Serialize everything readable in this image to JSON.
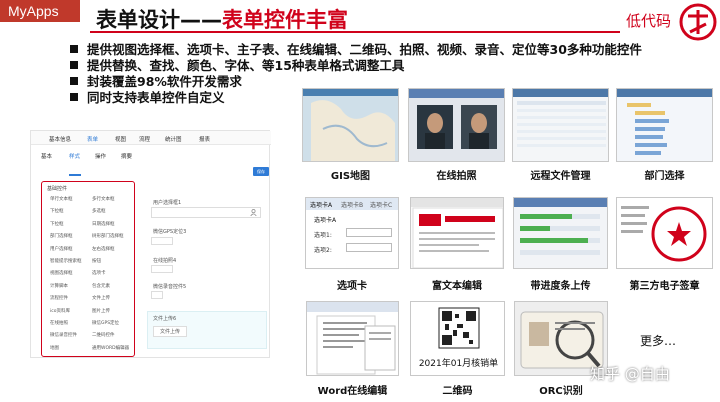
{
  "brand": "MyApps",
  "title_prefix": "表单设计——",
  "title_highlight": "表单控件丰富",
  "tag": "低代码",
  "bullets": [
    "提供视图选择框、选项卡、主子表、在线编辑、二维码、拍照、视频、录音、定位等30多种功能控件",
    "提供替换、查找、颜色、字体、等15种表单格式调整工具",
    "封装覆盖98%软件开发需求",
    "同时支持表单控件自定义"
  ],
  "form": {
    "top_tabs": [
      "基本信息",
      "表单",
      "视图",
      "流程",
      "统计图",
      "报表"
    ],
    "sub_tabs": [
      "基本",
      "样式",
      "操作",
      "摘要"
    ],
    "button": "保存",
    "palette_title": "基础控件",
    "palette_items": [
      [
        "单行文本框",
        "多行文本框"
      ],
      [
        "下拉框",
        "多选框"
      ],
      [
        "下拉框",
        "日期选择框"
      ],
      [
        "部门选择框",
        "树形部门选择框"
      ],
      [
        "用户选择框",
        "左右选择框"
      ],
      [
        "智能提示搜索框",
        "按钮"
      ],
      [
        "视图选择框",
        "选项卡"
      ],
      [
        "计算脚本",
        "包含元素"
      ],
      [
        "流程控件",
        "文件上传"
      ],
      [
        "ico资料库",
        "图片上传"
      ],
      [
        "在线拍照",
        "微信GPS定位"
      ],
      [
        "微信录音控件",
        "二维码控件"
      ],
      [
        "地图",
        "通用WORD编辑器"
      ]
    ],
    "fields": [
      "用户选择框1",
      "微信GPS定位3",
      "在线拍照4",
      "微信录音控件5",
      "文件上传6"
    ],
    "upload_button": "文件上传"
  },
  "gallery": [
    {
      "caption": "GIS地图"
    },
    {
      "caption": "在线拍照"
    },
    {
      "caption": "远程文件管理"
    },
    {
      "caption": "部门选择"
    },
    {
      "caption": "选项卡",
      "tab_labels": [
        "选项卡A",
        "选项卡B",
        "选项卡C"
      ],
      "inner_title": "选项卡A",
      "inner_fields": [
        "选项1:",
        "选项2:"
      ]
    },
    {
      "caption": "富文本编辑"
    },
    {
      "caption": "带进度条上传"
    },
    {
      "caption": "第三方电子签章"
    },
    {
      "caption": "Word在线编辑"
    },
    {
      "caption": "二维码",
      "overlay": "2021年01月核销单"
    },
    {
      "caption": "ORC识别"
    }
  ],
  "more": "更多…",
  "watermark": "知乎 @自由"
}
